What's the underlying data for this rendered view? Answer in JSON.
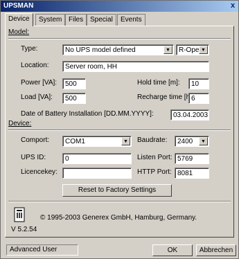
{
  "window": {
    "title": "UPSMAN",
    "close_glyph": "x"
  },
  "tabs": [
    "Device",
    "System",
    "Files",
    "Special",
    "Events"
  ],
  "model_section": {
    "heading": "Model:"
  },
  "type": {
    "label": "Type:",
    "value": "No UPS model defined",
    "mode_value": "R-Open"
  },
  "location": {
    "label": "Location:",
    "value": "Server room, HH"
  },
  "power": {
    "label": "Power [VA]:",
    "value": "500"
  },
  "load": {
    "label": "Load [VA]:",
    "value": "500"
  },
  "hold_time": {
    "label": "Hold time [m]:",
    "value": "10"
  },
  "recharge_time": {
    "label": "Recharge time [h]:",
    "value": "6"
  },
  "battery_date": {
    "label": "Date of Battery Installation [DD.MM.YYYY]:",
    "value": "03.04.2003"
  },
  "device_section": {
    "heading": "Device:"
  },
  "comport": {
    "label": "Comport:",
    "value": "COM1"
  },
  "baudrate": {
    "label": "Baudrate:",
    "value": "2400"
  },
  "ups_id": {
    "label": "UPS ID:",
    "value": "0"
  },
  "listen_port": {
    "label": "Listen Port:",
    "value": "5769"
  },
  "licencekey": {
    "label": "Licencekey:",
    "value": ""
  },
  "http_port": {
    "label": "HTTP Port:",
    "value": "8081"
  },
  "reset_button": {
    "label": "Reset to Factory Settings"
  },
  "about": {
    "copyright": "© 1995-2003 Generex GmbH, Hamburg, Germany.",
    "version": "V  5.2.54",
    "icon": "ups-device-icon"
  },
  "status": {
    "user_level": "Advanced User"
  },
  "buttons": {
    "ok": "OK",
    "cancel": "Abbrechen"
  }
}
